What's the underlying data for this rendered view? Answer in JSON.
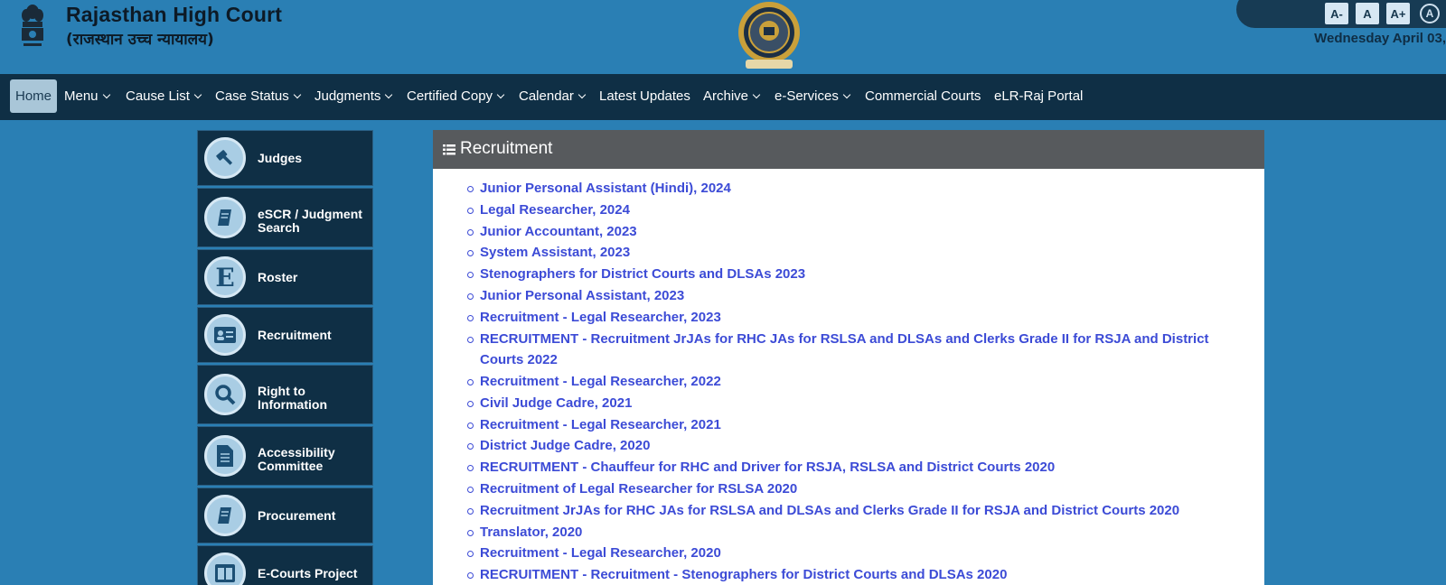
{
  "header": {
    "title": "Rajasthan High Court",
    "subtitle": "(राजस्थान उच्च न्यायालय)",
    "date": "Wednesday April 03,",
    "font_controls": [
      "A-",
      "A",
      "A+"
    ],
    "contrast_label": "A",
    "colors": {
      "background": "#2a7fb4",
      "nav": "#0f2f45",
      "link": "#3c4bd6"
    }
  },
  "nav": {
    "items": [
      {
        "label": "Home",
        "active": true,
        "dropdown": false
      },
      {
        "label": "Menu",
        "dropdown": true
      },
      {
        "label": "Cause List",
        "dropdown": true
      },
      {
        "label": "Case Status",
        "dropdown": true
      },
      {
        "label": "Judgments",
        "dropdown": true
      },
      {
        "label": "Certified Copy",
        "dropdown": true
      },
      {
        "label": "Calendar",
        "dropdown": true
      },
      {
        "label": "Latest Updates",
        "dropdown": false
      },
      {
        "label": "Archive",
        "dropdown": true
      },
      {
        "label": "e-Services",
        "dropdown": true
      },
      {
        "label": "Commercial Courts",
        "dropdown": false
      },
      {
        "label": "eLR-Raj Portal",
        "dropdown": false
      }
    ]
  },
  "sidebar": {
    "items": [
      {
        "label": "Judges",
        "icon": "gavel-icon"
      },
      {
        "label": "eSCR / Judgment Search",
        "icon": "book-icon"
      },
      {
        "label": "Roster",
        "icon": "letter-e-icon"
      },
      {
        "label": "Recruitment",
        "icon": "id-card-icon"
      },
      {
        "label": "Right to Information",
        "icon": "magnifier-icon"
      },
      {
        "label": "Accessibility Committee",
        "icon": "document-icon"
      },
      {
        "label": "Procurement",
        "icon": "book-icon"
      },
      {
        "label": "E-Courts Project",
        "icon": "panels-icon"
      }
    ]
  },
  "main": {
    "title": "Recruitment",
    "items": [
      "Junior Personal Assistant (Hindi), 2024",
      "Legal Researcher, 2024",
      "Junior Accountant, 2023",
      "System Assistant, 2023",
      "Stenographers for District Courts and DLSAs 2023",
      "Junior Personal Assistant, 2023",
      "Recruitment - Legal Researcher, 2023",
      "RECRUITMENT - Recruitment JrJAs for RHC JAs for RSLSA and DLSAs and Clerks Grade II for RSJA and District Courts 2022",
      "Recruitment - Legal Researcher, 2022",
      "Civil Judge Cadre, 2021",
      "Recruitment - Legal Researcher, 2021",
      "District Judge Cadre, 2020",
      "RECRUITMENT - Chauffeur for RHC and Driver for RSJA, RSLSA and District Courts 2020",
      "Recruitment of Legal Researcher for RSLSA 2020",
      "Recruitment JrJAs for RHC JAs for RSLSA and DLSAs and Clerks Grade II for RSJA and District Courts 2020",
      "Translator, 2020",
      "Recruitment - Legal Researcher, 2020",
      "RECRUITMENT - Recruitment - Stenographers for District Courts and DLSAs 2020"
    ]
  }
}
